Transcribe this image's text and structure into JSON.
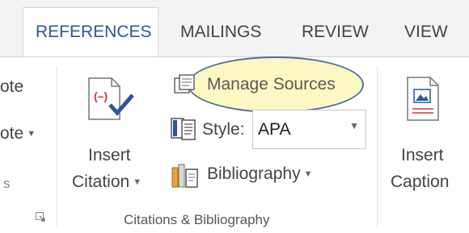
{
  "tabs": [
    {
      "label": "REFERENCES",
      "active": true
    },
    {
      "label": "MAILINGS"
    },
    {
      "label": "REVIEW"
    },
    {
      "label": "VIEW"
    }
  ],
  "left_group": {
    "item1": "ote",
    "item2": "ote",
    "item3": "s"
  },
  "insert_citation": {
    "line1": "Insert",
    "line2": "Citation"
  },
  "manage_sources": "Manage Sources",
  "style": {
    "label": "Style:",
    "value": "APA"
  },
  "bibliography": "Bibliography",
  "group_label": "Citations & Bibliography",
  "insert_caption": {
    "line1": "Insert",
    "line2": "Caption"
  },
  "colors": {
    "accent": "#2b579a",
    "highlight": "#fbf8c3",
    "ellipse_border": "#4f6f9a"
  }
}
